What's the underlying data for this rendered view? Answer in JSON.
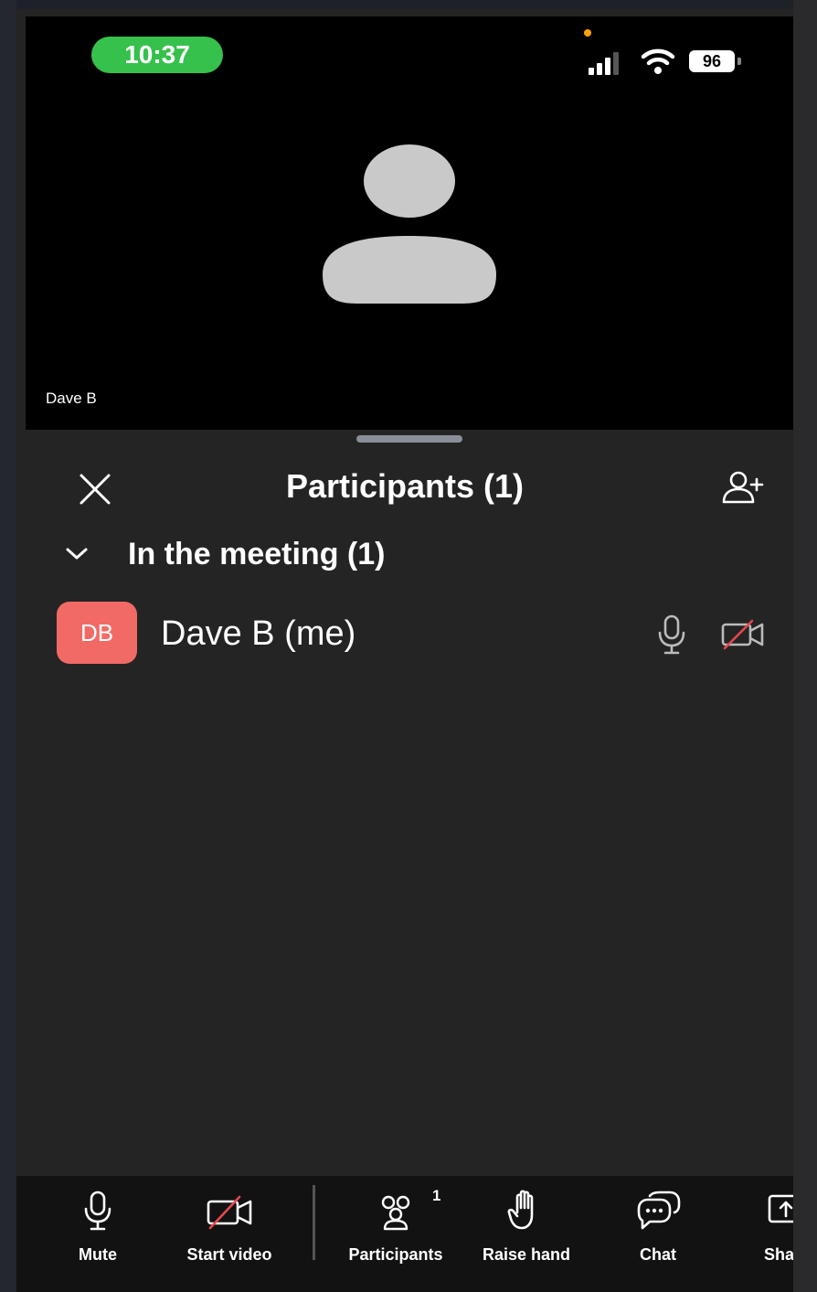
{
  "status_bar": {
    "time": "10:37",
    "battery": "96"
  },
  "video": {
    "participant_name": "Dave B"
  },
  "participants_sheet": {
    "title": "Participants (1)",
    "section_title": "In the meeting (1)",
    "participants": [
      {
        "initials": "DB",
        "name": "Dave B (me)",
        "avatar_color": "#f26a66"
      }
    ]
  },
  "toolbar": {
    "mute": "Mute",
    "start_video": "Start video",
    "participants": "Participants",
    "participants_count": "1",
    "raise_hand": "Raise hand",
    "chat": "Chat",
    "share": "Sha"
  },
  "colors": {
    "accent_green": "#35c14b",
    "avatar": "#f26a66",
    "muted_red": "#e5484d"
  }
}
